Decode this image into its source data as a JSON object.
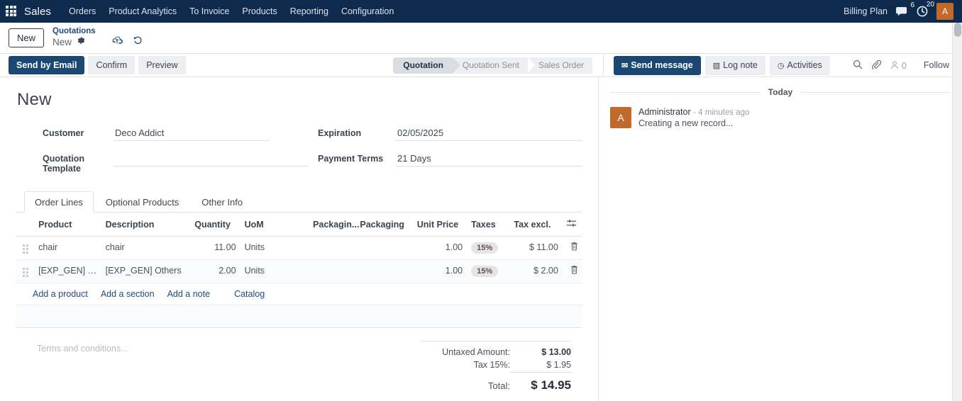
{
  "navbar": {
    "apps_icon": "apps-grid-icon",
    "brand": "Sales",
    "menu": [
      {
        "label": "Orders"
      },
      {
        "label": "Product Analytics"
      },
      {
        "label": "To Invoice"
      },
      {
        "label": "Products"
      },
      {
        "label": "Reporting"
      },
      {
        "label": "Configuration"
      }
    ],
    "billing_plan": "Billing Plan",
    "messages_icon": "speech-bubble-icon",
    "messages_count": "6",
    "activities_icon": "clock-icon",
    "activities_count": "20",
    "avatar_initial": "A",
    "avatar_color": "#c1682b"
  },
  "control_panel": {
    "new_button": "New",
    "breadcrumb_parent": "Quotations",
    "breadcrumb_current": "New",
    "gear_icon": "gear-icon",
    "save_icon": "cloud-upload-icon",
    "discard_icon": "undo-icon"
  },
  "action_bar": {
    "buttons": [
      {
        "label": "Send by Email",
        "style": "primary"
      },
      {
        "label": "Confirm",
        "style": "secondary"
      },
      {
        "label": "Preview",
        "style": "secondary"
      }
    ],
    "statuses": [
      {
        "label": "Quotation",
        "active": true
      },
      {
        "label": "Quotation Sent",
        "active": false
      },
      {
        "label": "Sales Order",
        "active": false
      }
    ]
  },
  "chatter_toolbar": {
    "send_message": "Send message",
    "log_note": "Log note",
    "activities": "Activities",
    "search_icon": "search-icon",
    "attachment_icon": "paperclip-icon",
    "followers_icon": "person-icon",
    "followers_count": "0",
    "follow_label": "Follow"
  },
  "form": {
    "title": "New",
    "fields_left": [
      {
        "label": "Customer",
        "value": "Deco Addict"
      },
      {
        "label": "Quotation Template",
        "value": ""
      }
    ],
    "fields_right": [
      {
        "label": "Expiration",
        "value": "02/05/2025"
      },
      {
        "label": "Payment Terms",
        "value": "21 Days"
      }
    ]
  },
  "notebook": {
    "tabs": [
      {
        "label": "Order Lines",
        "active": true
      },
      {
        "label": "Optional Products",
        "active": false
      },
      {
        "label": "Other Info",
        "active": false
      }
    ],
    "columns": [
      "Product",
      "Description",
      "Quantity",
      "UoM",
      "Packagin...",
      "Packaging",
      "Unit Price",
      "Taxes",
      "Tax excl."
    ],
    "options_icon": "sliders-icon",
    "rows": [
      {
        "handle": "drag-handle-icon",
        "product": "chair",
        "description": "chair",
        "quantity": "11.00",
        "uom": "Units",
        "packaging_qty": "",
        "packaging": "",
        "unit_price": "1.00",
        "taxes": "15%",
        "tax_excl": "$ 11.00",
        "delete_icon": "trash-icon"
      },
      {
        "handle": "drag-handle-icon",
        "product": "[EXP_GEN] Oth...",
        "description": "[EXP_GEN] Others",
        "quantity": "2.00",
        "uom": "Units",
        "packaging_qty": "",
        "packaging": "",
        "unit_price": "1.00",
        "taxes": "15%",
        "tax_excl": "$ 2.00",
        "delete_icon": "trash-icon"
      }
    ],
    "add_links": [
      {
        "label": "Add a product"
      },
      {
        "label": "Add a section"
      },
      {
        "label": "Add a note"
      },
      {
        "label": "Catalog"
      }
    ]
  },
  "totals": {
    "terms_placeholder": "Terms and conditions...",
    "untaxed_label": "Untaxed Amount:",
    "untaxed_value": "$ 13.00",
    "tax_label": "Tax 15%:",
    "tax_value": "$ 1.95",
    "total_label": "Total:",
    "total_value": "$ 14.95"
  },
  "chatter": {
    "day_separator": "Today",
    "messages": [
      {
        "avatar_initial": "A",
        "author": "Administrator",
        "time": "- 4 minutes ago",
        "body": "Creating a new record..."
      }
    ]
  }
}
